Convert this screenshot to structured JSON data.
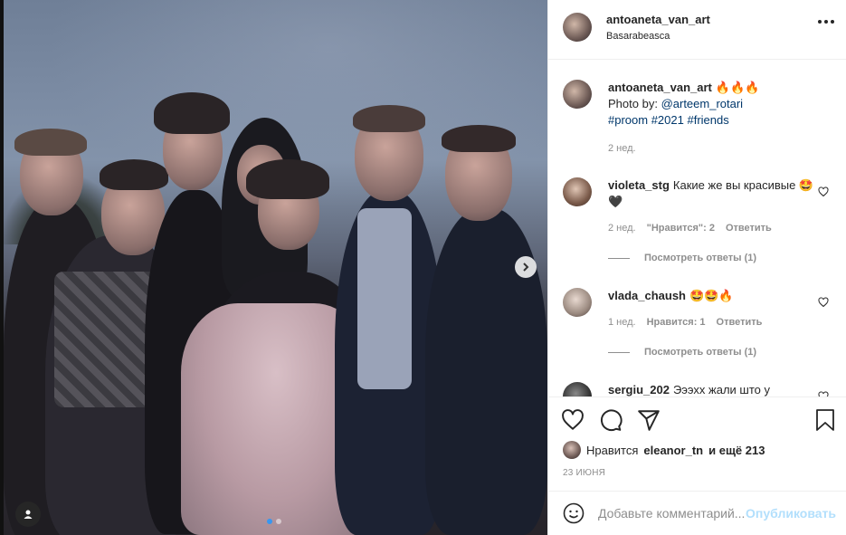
{
  "post": {
    "username": "antoaneta_van_art",
    "location": "Basarabeasca"
  },
  "caption": {
    "username": "antoaneta_van_art",
    "emoji": "🔥🔥🔥",
    "photo_by_label": "Photo by:",
    "photo_by_user": "@arteem_rotari",
    "hashtags": [
      "#proom",
      "#2021",
      "#friends"
    ],
    "time": "2 нед."
  },
  "comments": [
    {
      "username": "violeta_stg",
      "text": "Какие же вы красивые 🤩🖤",
      "time": "2 нед.",
      "likes": "\"Нравится\": 2",
      "reply": "Ответить",
      "view_replies": "Посмотреть ответы (1)"
    },
    {
      "username": "vlada_chaush",
      "text": "🤩🤩🔥",
      "time": "1 нед.",
      "likes": "Нравится: 1",
      "reply": "Ответить",
      "view_replies": "Посмотреть ответы (1)"
    },
    {
      "username": "sergiu_202",
      "text": "Эээхх жали што у"
    }
  ],
  "likes": {
    "prefix": "Нравится",
    "user": "eleanor_tn",
    "suffix": "и ещё 213"
  },
  "date": "23 ИЮНЯ",
  "add_comment": {
    "placeholder": "Добавьте комментарий...",
    "post_label": "Опубликовать"
  },
  "carousel": {
    "current": 1,
    "total": 2
  }
}
